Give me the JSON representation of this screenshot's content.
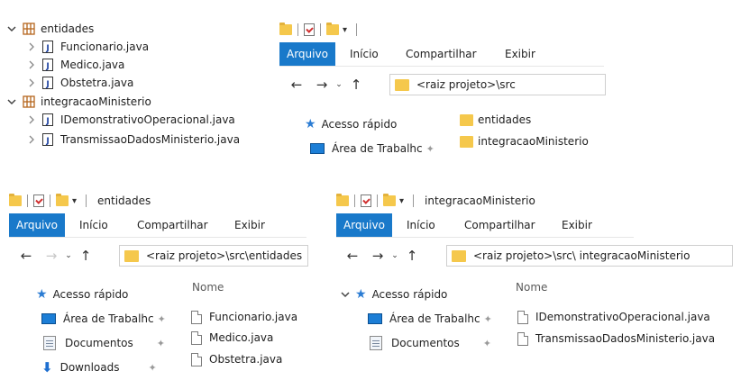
{
  "tree": {
    "rows": [
      {
        "label": "entidades",
        "expanded": true
      },
      {
        "label": "Funcionario.java"
      },
      {
        "label": "Medico.java"
      },
      {
        "label": "Obstetra.java"
      },
      {
        "label": "integracaoMinisterio",
        "expanded": true
      },
      {
        "label": "IDemonstrativoOperacional.java"
      },
      {
        "label": "TransmissaoDadosMinisterio.java"
      }
    ]
  },
  "explorer_src": {
    "ribbon": {
      "tabs": [
        "Arquivo",
        "Início",
        "Compartilhar",
        "Exibir"
      ]
    },
    "address": "<raiz projeto>\\src",
    "quick_access": {
      "label": "Acesso rápido",
      "items": [
        "Área de Trabalhc"
      ]
    },
    "folders": [
      "entidades",
      "integracaoMinisterio"
    ]
  },
  "explorer_entidades": {
    "title": "entidades",
    "ribbon": {
      "tabs": [
        "Arquivo",
        "Início",
        "Compartilhar",
        "Exibir"
      ]
    },
    "address": "<raiz projeto>\\src\\entidades",
    "quick_access": {
      "label": "Acesso rápido",
      "items": [
        "Área de Trabalhc",
        "Documentos",
        "Downloads"
      ]
    },
    "column_header": "Nome",
    "files": [
      "Funcionario.java",
      "Medico.java",
      "Obstetra.java"
    ]
  },
  "explorer_integracao": {
    "title": "integracaoMinisterio",
    "ribbon": {
      "tabs": [
        "Arquivo",
        "Início",
        "Compartilhar",
        "Exibir"
      ]
    },
    "address": "<raiz projeto>\\src\\ integracaoMinisterio",
    "quick_access": {
      "label": "Acesso rápido",
      "items": [
        "Área de Trabalhc",
        "Documentos"
      ]
    },
    "column_header": "Nome",
    "files": [
      "IDemonstrativoOperacional.java",
      "TransmissaoDadosMinisterio.java"
    ]
  },
  "colors": {
    "accent": "#1979ca",
    "folder": "#f5c84c",
    "package": "#b5651d"
  }
}
